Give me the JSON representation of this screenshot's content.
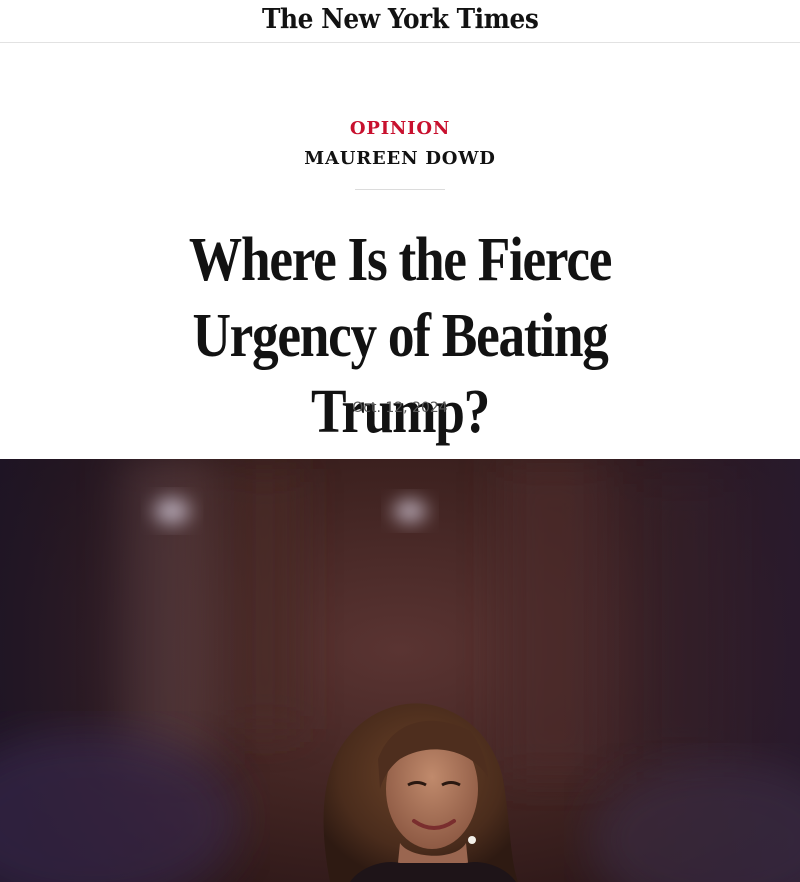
{
  "masthead": {
    "logo_text": "The New York Times"
  },
  "article": {
    "section": "OPINION",
    "author": "MAUREEN DOWD",
    "headline": "Where Is the Fierce Urgency of Beating Trump?",
    "date": "Oct. 12, 2024"
  },
  "hero_image": {
    "subject": "woman-smiling-on-stage"
  },
  "colors": {
    "opinion_red": "#c8102e",
    "text_dark": "#121212",
    "date_gray": "#555555",
    "divider": "#e2e2e2"
  }
}
